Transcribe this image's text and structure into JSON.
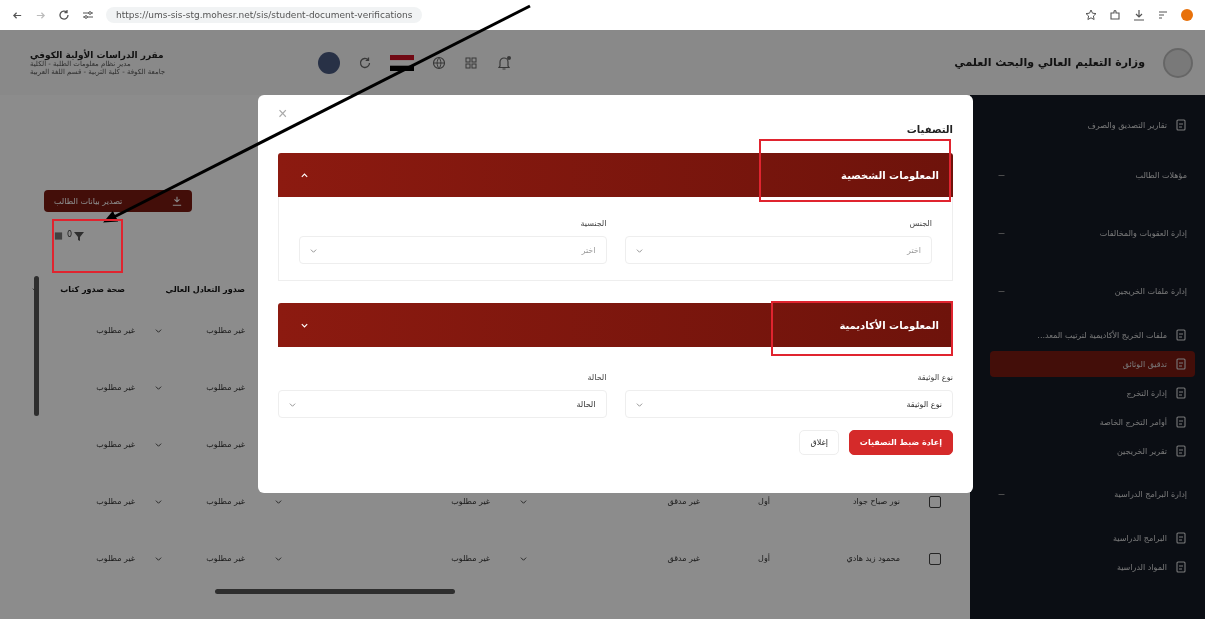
{
  "browser": {
    "url": "https://ums-sis-stg.mohesr.net/sis/student-document-verifications"
  },
  "header": {
    "app_title": "وزارة التعليم العالي والبحث العلمي",
    "user_lines": [
      "مقرر الدراسات الأولية الكوفي",
      "مدير نظام معلومات الطلبة - الكلية",
      "جامعة الكوفة - كلية التربية - قسم اللغة العربية"
    ]
  },
  "sidebar": {
    "items": [
      {
        "kind": "link",
        "label": "تقارير التصديق والصرف",
        "selected": false
      },
      {
        "kind": "group",
        "label": "مؤهلات الطالب"
      },
      {
        "kind": "group",
        "label": "إدارة العقوبات والمخالفات"
      },
      {
        "kind": "group",
        "label": "إدارة ملفات الخريجين"
      },
      {
        "kind": "link",
        "label": "ملفات الخريج الأكاديمية لترتيب المعد...",
        "selected": false
      },
      {
        "kind": "link",
        "label": "تدقيق الوثائق",
        "selected": true
      },
      {
        "kind": "link",
        "label": "إدارة التخرج",
        "selected": false
      },
      {
        "kind": "link",
        "label": "أوامر التخرج الخاصة",
        "selected": false
      },
      {
        "kind": "link",
        "label": "تقرير الخريجين",
        "selected": false
      },
      {
        "kind": "group",
        "label": "إدارة البرامج الدراسية"
      },
      {
        "kind": "link",
        "label": "البرامج الدراسية",
        "selected": false
      },
      {
        "kind": "link",
        "label": "المواد الدراسية",
        "selected": false
      }
    ]
  },
  "toolbar": {
    "export_button": "تصدير بيانات الطالب",
    "filter_count": "0"
  },
  "table": {
    "columns": [
      {
        "label": "صدور التعادل العالي"
      },
      {
        "label": "صحة صدور كتاب"
      }
    ],
    "rows": [
      {
        "cells": [
          "غير مطلوب",
          "غير مطلوب"
        ]
      },
      {
        "cells": [
          "غير مطلوب",
          "غير مطلوب"
        ]
      },
      {
        "cells": [
          "غير مطلوب",
          "غير مطلوب"
        ]
      },
      {
        "cells": [
          "نور صباح جواد",
          "أول",
          "غير مدقق",
          "غير مطلوب",
          "غير مطلوب",
          "غير مطلوب"
        ],
        "checked": false
      },
      {
        "cells": [
          "محمود زيد هادي",
          "أول",
          "غير مدقق",
          "غير مطلوب",
          "غير مطلوب",
          "غير مطلوب"
        ],
        "checked": false
      }
    ]
  },
  "modal": {
    "title": "التصفيات",
    "close": "×",
    "sections": [
      {
        "title": "المعلومات الشخصية",
        "expanded": true,
        "fields": [
          {
            "label": "الجنس",
            "placeholder": "اختر"
          },
          {
            "label": "الجنسية",
            "placeholder": "اختر"
          }
        ]
      },
      {
        "title": "المعلومات الأكاديمية",
        "expanded": false,
        "fields": [
          {
            "label": "نوع الوثيقة",
            "value": "نوع الوثيقة"
          },
          {
            "label": "الحالة",
            "value": "الحالة"
          }
        ]
      }
    ],
    "buttons": [
      {
        "kind": "primary",
        "label": "إعادة ضبط التصفيات"
      },
      {
        "kind": "secondary",
        "label": "إغلاق"
      }
    ]
  }
}
